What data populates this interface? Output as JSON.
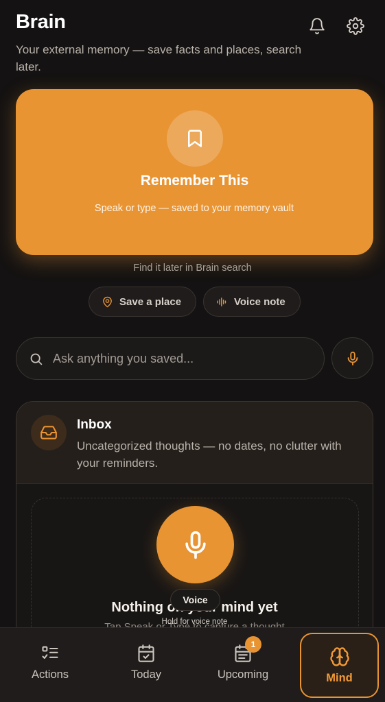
{
  "header": {
    "title": "Brain",
    "subtitle": "Your external memory — save facts and places, search later."
  },
  "remember_card": {
    "title": "Remember This",
    "subtitle": "Speak or type — saved to your memory vault",
    "icon": "bookmark-icon"
  },
  "find_later": "Find it later in Brain search",
  "chips": {
    "save_place": "Save a place",
    "voice_note": "Voice note"
  },
  "search": {
    "placeholder": "Ask anything you saved..."
  },
  "inbox": {
    "title": "Inbox",
    "description": "Uncategorized thoughts — no dates, no clutter with your reminders.",
    "empty_title": "Nothing on your mind yet",
    "empty_hint": "Tap Speak or Type to capture a thought",
    "voice_tooltip": "Voice",
    "hold_tooltip": "Hold for voice note"
  },
  "nav": {
    "items": [
      {
        "label": "Actions",
        "icon": "checklist-icon"
      },
      {
        "label": "Today",
        "icon": "calendar-check-icon"
      },
      {
        "label": "Upcoming",
        "icon": "calendar-list-icon",
        "badge": "1"
      },
      {
        "label": "Mind",
        "icon": "brain-icon",
        "active": true
      }
    ]
  },
  "colors": {
    "accent": "#e99433",
    "background": "#141212"
  }
}
